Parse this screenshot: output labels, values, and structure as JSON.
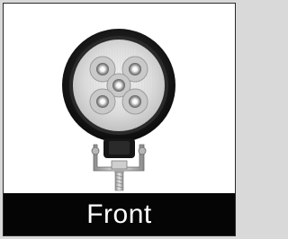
{
  "caption": {
    "label": "Front"
  },
  "product_image": {
    "icon": "round-led-work-light-icon",
    "led_count": 5
  },
  "colors": {
    "caption_bg": "#050505",
    "caption_text": "#ffffff",
    "page_bg": "#d9d9d9"
  }
}
